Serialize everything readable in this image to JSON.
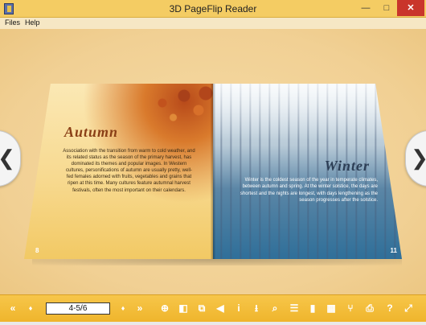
{
  "window": {
    "title": "3D PageFlip Reader",
    "minimize_glyph": "—",
    "maximize_glyph": "□",
    "close_glyph": "✕"
  },
  "menu": {
    "files": "Files",
    "help": "Help"
  },
  "book": {
    "left_page": {
      "heading": "Autumn",
      "body": "Association with the transition from warm to cold weather, and its related status as the season of the primary harvest, has dominated its themes and popular images. In Western cultures, personifications of autumn are usually pretty, well-fed females adorned with fruits, vegetables and grains that ripen at this time. Many cultures feature autumnal harvest festivals, often the most important on their calendars.",
      "page_number": "8"
    },
    "right_page": {
      "heading": "Winter",
      "body": "Winter is the coldest season of the year in temperate climates, between autumn and spring. At the winter solstice, the days are shortest and the nights are longest, with days lengthening as the season progresses after the solstice.",
      "page_number": "11"
    }
  },
  "navigation": {
    "prev_glyph": "❮",
    "next_glyph": "❯"
  },
  "toolbar": {
    "page_indicator": "4-5/6",
    "icons": {
      "first": "«",
      "prev": "♦",
      "next": "♦",
      "last": "»",
      "zoom": "⊕",
      "thumbnails": "◧",
      "pages": "⧉",
      "sound": "◀",
      "info": "i",
      "download": "⭳",
      "search": "⌕",
      "toc": "☰",
      "bookmark": "▮",
      "grid": "▦",
      "share": "⑂",
      "print": "⎙",
      "help": "?",
      "fullscreen": "⤢"
    }
  }
}
